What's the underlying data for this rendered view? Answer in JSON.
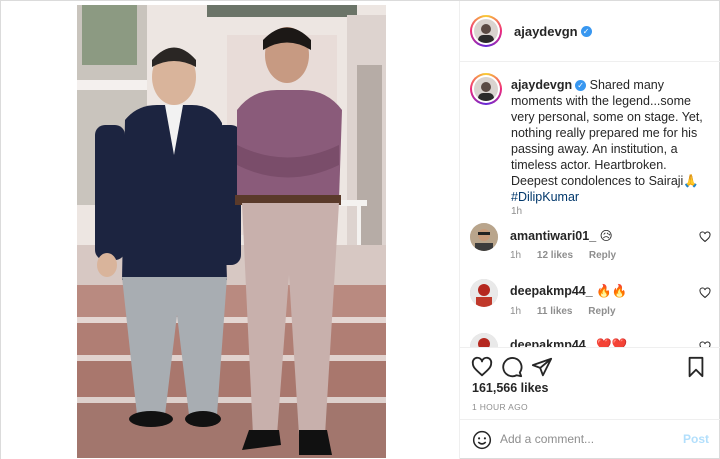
{
  "post": {
    "username": "ajaydevgn",
    "verified": true
  },
  "caption": {
    "username": "ajaydevgn",
    "text": "Shared many moments with the legend...some very personal, some on stage. Yet, nothing really prepared me for his passing away. An institution, a timeless actor. Heartbroken. Deepest condolences to Sairaji🙏",
    "hashtag": "#DilipKumar",
    "time": "1h"
  },
  "comments": [
    {
      "username": "amantiwari01_",
      "text": "😥",
      "time": "1h",
      "likes": "12 likes",
      "reply": "Reply"
    },
    {
      "username": "deepakmp44_",
      "text": "🔥🔥",
      "time": "1h",
      "likes": "11 likes",
      "reply": "Reply"
    },
    {
      "username": "deepakmp44_",
      "text": "❤️❤️",
      "time": "",
      "likes": "",
      "reply": ""
    }
  ],
  "actions": {
    "likes": "161,566 likes",
    "time": "1 HOUR AGO"
  },
  "add_comment": {
    "placeholder": "Add a comment...",
    "post_label": "Post"
  },
  "icons": {
    "like": "heart-icon",
    "comment": "comment-bubble-icon",
    "share": "paper-plane-icon",
    "save": "bookmark-icon",
    "emoji": "emoji-smile-icon",
    "verified": "verified-badge-icon"
  },
  "colors": {
    "link": "#00376b",
    "verified": "#3897f0",
    "post_disabled": "#b2dffc",
    "muted": "#8e8e8e"
  }
}
